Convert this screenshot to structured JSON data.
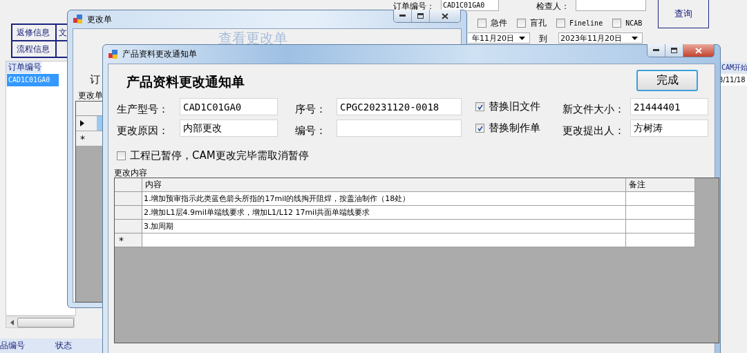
{
  "main_window": {
    "order_no_label": "订单编号：",
    "order_no": "CAD1C01GA0",
    "checker_label": "检查人：",
    "query_button": "查询",
    "filters": [
      {
        "label": "急件",
        "checked": false
      },
      {
        "label": "盲孔",
        "checked": false
      },
      {
        "label": "Fineline",
        "checked": false
      },
      {
        "label": "NCAB",
        "checked": false
      }
    ],
    "date_from": "年11月20日",
    "date_to_label": "到",
    "date_to": "2023年11月20日",
    "side_buttons": [
      "返修信息",
      "文",
      "流程信息"
    ],
    "order_grid": {
      "columns": [
        "订单编号"
      ],
      "rows": [
        {
          "cells": [
            "CAD1C01GA0"
          ],
          "selected": true
        }
      ]
    },
    "right_grid": {
      "columns": [
        "CAM开始"
      ],
      "rows": [
        "3/11/18"
      ]
    },
    "bottom_grid": {
      "columns": [
        "品编号",
        "状态"
      ]
    }
  },
  "change_window": {
    "title": "更改单",
    "heading": "查看更改单",
    "tab": "订",
    "grid_label": "更改单",
    "rows": [
      {
        "selected": true
      }
    ],
    "new_row_marker": "*"
  },
  "notice_dialog": {
    "title": "产品资料更改通知单",
    "heading": "产品资料更改通知单",
    "done_button": "完成",
    "fields": [
      {
        "label": "生产型号：",
        "value": "CAD1C01GA0"
      },
      {
        "label": "序号：",
        "value": "CPGC20231120-0018"
      },
      {
        "label": "新文件大小：",
        "value": "21444401"
      },
      {
        "label": "更改原因：",
        "value": "内部更改"
      },
      {
        "label": "编号："
      },
      {
        "label": "更改提出人：",
        "value": "方树涛"
      }
    ],
    "options": [
      {
        "label": "替换旧文件",
        "checked": true
      },
      {
        "label": "替换制作单",
        "checked": true
      }
    ],
    "paused": {
      "label": "工程已暂停，CAM更改完毕需取消暂停",
      "checked": false
    },
    "content_group": "更改内容",
    "grid": {
      "columns": [
        "内容",
        "备注"
      ],
      "rows": [
        {
          "content": "1.增加预审指示此类蓝色箭头所指的17mil的线掏开阻焊，按盖油制作（18处）"
        },
        {
          "content": "2.增加L1层4.9mil单端线要求，增加L1/L12 17mil共面单端线要求"
        },
        {
          "content": "3.加周期"
        }
      ],
      "new_row_marker": "*"
    }
  }
}
